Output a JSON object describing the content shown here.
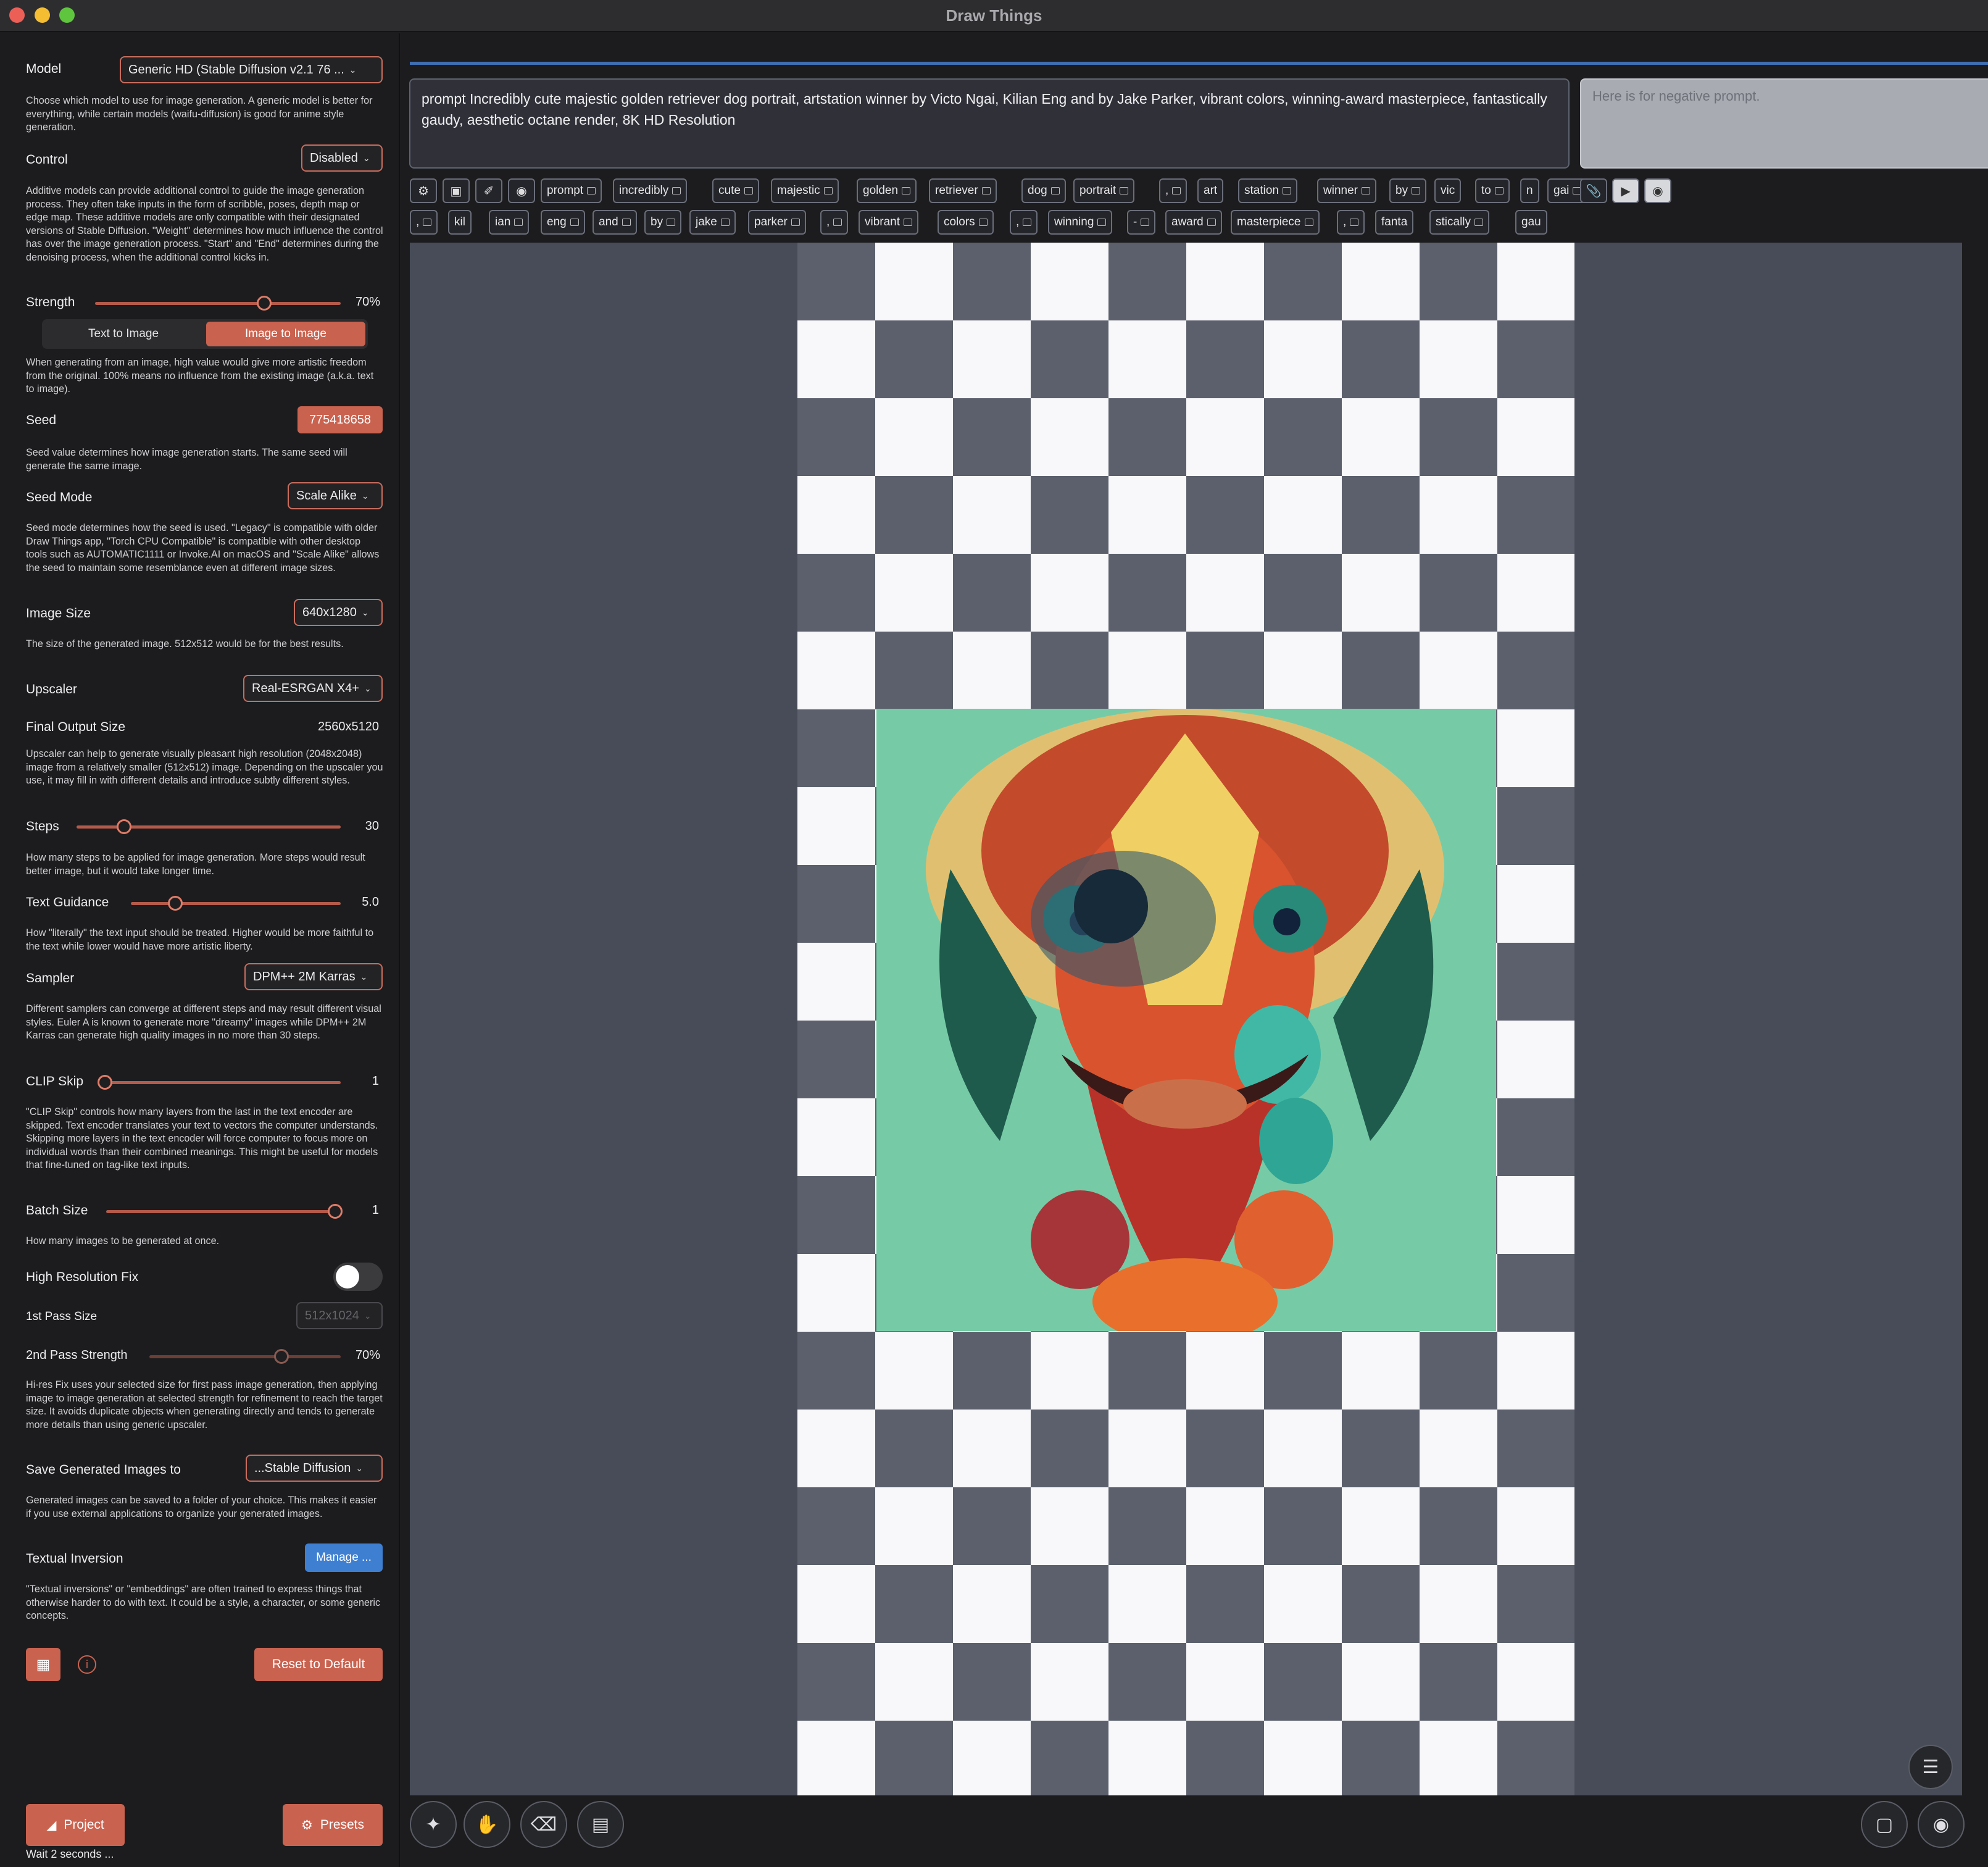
{
  "app": {
    "title": "Draw Things"
  },
  "sidebar": {
    "model": {
      "label": "Model",
      "value": "Generic HD (Stable Diffusion v2.1 76 ...",
      "desc": "Choose which model to use for image generation. A generic model is better for everything, while certain models (waifu-diffusion) is good for anime style generation."
    },
    "control": {
      "label": "Control",
      "value": "Disabled",
      "desc": "Additive models can provide additional control to guide the image generation process. They often take inputs in the form of scribble, poses, depth map or edge map. These additive models are only compatible with their designated versions of Stable Diffusion. \"Weight\" determines how much influence the control has over the image generation process. \"Start\" and \"End\" determines during the denoising process, when the additional control kicks in."
    },
    "strength": {
      "label": "Strength",
      "value": "70%",
      "level": 0.7
    },
    "mode": {
      "text_to_image": "Text to Image",
      "image_to_image": "Image to Image",
      "desc": "When generating from an image, high value would give more artistic freedom from the original. 100% means no influence from the existing image (a.k.a. text to image)."
    },
    "seed": {
      "label": "Seed",
      "value": "775418658",
      "desc": "Seed value determines how image generation starts. The same seed will generate the same image."
    },
    "seed_mode": {
      "label": "Seed Mode",
      "value": "Scale Alike",
      "desc": "Seed mode determines how the seed is used. \"Legacy\" is compatible with older Draw Things app, \"Torch CPU Compatible\" is compatible with other desktop tools such as AUTOMATIC1111 or Invoke.AI on macOS and \"Scale Alike\" allows the seed to maintain some resemblance even at different image sizes."
    },
    "image_size": {
      "label": "Image Size",
      "value": "640x1280",
      "desc": "The size of the generated image. 512x512 would be for the best results."
    },
    "upscaler": {
      "label": "Upscaler",
      "value": "Real-ESRGAN X4+"
    },
    "final_output": {
      "label": "Final Output Size",
      "value": "2560x5120",
      "desc": "Upscaler can help to generate visually pleasant high resolution (2048x2048) image from a relatively smaller (512x512) image. Depending on the upscaler you use, it may fill in with different details and introduce subtly different styles."
    },
    "steps": {
      "label": "Steps",
      "value": "30",
      "level": 0.18,
      "desc": "How many steps to be applied for image generation. More steps would result better image, but it would take longer time."
    },
    "text_guidance": {
      "label": "Text Guidance",
      "value": "5.0",
      "level": 0.2,
      "desc": "How \"literally\" the text input should be treated. Higher would be more faithful to the text while lower would have more artistic liberty."
    },
    "sampler": {
      "label": "Sampler",
      "value": "DPM++ 2M Karras",
      "desc": "Different samplers can converge at different steps and may result different visual styles. Euler A is known to generate more \"dreamy\" images while DPM++ 2M Karras can generate high quality images in no more than 30 steps."
    },
    "clip_skip": {
      "label": "CLIP Skip",
      "value": "1",
      "level": 0.0,
      "desc": "\"CLIP Skip\" controls how many layers from the last in the text encoder are skipped. Text encoder translates your text to vectors the computer understands. Skipping more layers in the text encoder will force computer to focus more on individual words than their combined meanings. This might be useful for models that fine-tuned on tag-like text inputs."
    },
    "batch_size": {
      "label": "Batch Size",
      "value": "1",
      "level": 1.0,
      "desc": "How many images to be generated at once."
    },
    "hires_fix": {
      "label": "High Resolution Fix",
      "enabled": false
    },
    "first_pass": {
      "label": "1st Pass Size",
      "value": "512x1024"
    },
    "second_pass": {
      "label": "2nd Pass Strength",
      "value": "70%",
      "level": 0.7,
      "desc": "Hi-res Fix uses your selected size for first pass image generation, then applying image to image generation at selected strength for refinement to reach the target size. It avoids duplicate objects when generating directly and tends to generate more details than using generic upscaler."
    },
    "save_to": {
      "label": "Save Generated Images to",
      "value": "...Stable Diffusion",
      "desc": "Generated images can be saved to a folder of your choice. This makes it easier if you use external applications to organize your generated images."
    },
    "textual_inversion": {
      "label": "Textual Inversion",
      "button": "Manage ...",
      "desc": "\"Textual inversions\" or \"embeddings\" are often trained to express things that otherwise harder to do with text. It could be a style, a character, or some generic concepts."
    },
    "reset": "Reset to Default",
    "project": "Project",
    "presets": "Presets",
    "status": "Wait 2 seconds ..."
  },
  "prompt": {
    "text": "prompt Incredibly cute majestic golden retriever dog portrait, artstation winner by Victo Ngai, Kilian Eng and by Jake Parker, vibrant colors, winning-award masterpiece, fantastically gaudy, aesthetic octane render, 8K HD Resolution",
    "negative_placeholder": "Here is for negative prompt."
  },
  "tokens_row1": [
    "prompt",
    "incredibly",
    "cute",
    "majestic",
    "golden",
    "retriever",
    "dog",
    "portrait",
    ",",
    "art",
    "station",
    "winner",
    "by",
    "vic",
    "to",
    "n",
    "gai"
  ],
  "tokens_row2": [
    ",",
    "kil",
    "ian",
    "eng",
    "and",
    "by",
    "jake",
    "parker",
    ",",
    "vibrant",
    "colors",
    ",",
    "winning",
    "-",
    "award",
    "masterpiece",
    ",",
    "fanta",
    "stically",
    "gau"
  ],
  "colors": {
    "accent": "#c9624f",
    "blue": "#3f7fd1",
    "canvas": "#474c58"
  },
  "icons": [
    "settings-icon",
    "image-icon",
    "paperclip-icon",
    "play-icon",
    "magic-wand-icon",
    "hand-icon",
    "eraser-icon",
    "paint-roller-icon",
    "layers-icon",
    "note-icon",
    "camera-icon",
    "folder-icon",
    "gear-icon",
    "info-icon",
    "chip-icon"
  ]
}
